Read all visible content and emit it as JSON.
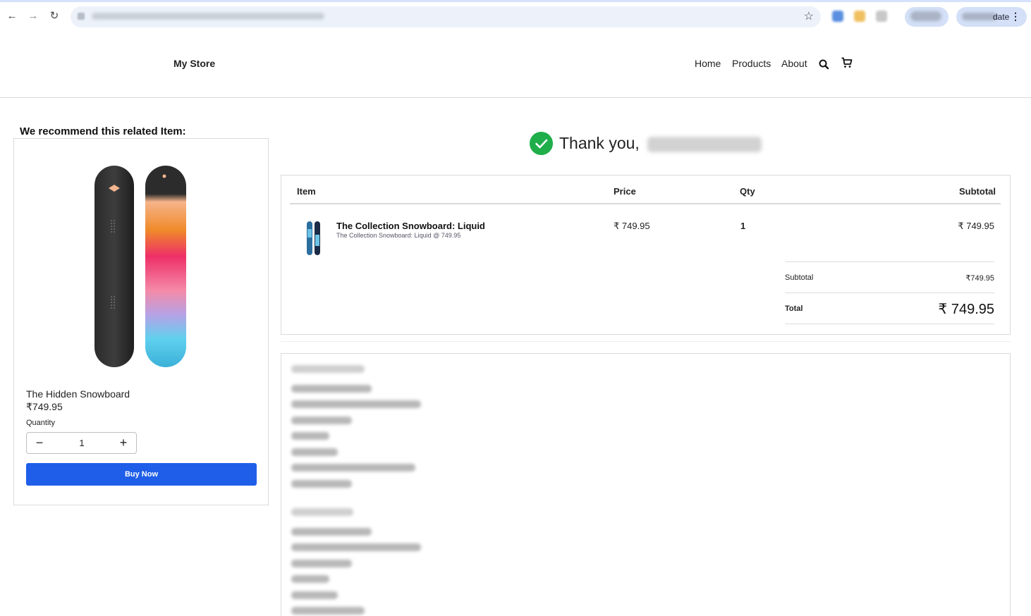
{
  "browser": {
    "back_icon": "←",
    "forward_icon": "→",
    "reload_icon": "↻",
    "star_icon": "☆",
    "update_label": "date",
    "menu_icon": "⋮"
  },
  "header": {
    "brand": "My Store",
    "nav": [
      "Home",
      "Products",
      "About"
    ],
    "search_icon": "search-icon",
    "cart_icon": "cart-icon"
  },
  "recommendation": {
    "title": "We recommend this related Item:",
    "product_name": "The Hidden Snowboard",
    "price": "₹749.95",
    "quantity_label": "Quantity",
    "quantity_value": "1",
    "minus": "−",
    "plus": "+",
    "buy_label": "Buy Now"
  },
  "confirmation": {
    "heading": "Thank you,",
    "check_color": "#1fae4a"
  },
  "order": {
    "columns": [
      "Item",
      "Price",
      "Qty",
      "Subtotal"
    ],
    "items": [
      {
        "title": "The Collection Snowboard: Liquid",
        "subtitle": "The Collection Snowboard: Liquid @ 749.95",
        "price": "₹ 749.95",
        "qty": "1",
        "subtotal": "₹ 749.95"
      }
    ],
    "subtotal_label": "Subtotal",
    "subtotal_value": "₹749.95",
    "total_label": "Total",
    "total_value": "₹ 749.95"
  },
  "colors": {
    "accent": "#1f5ee8",
    "success": "#1fae4a"
  }
}
